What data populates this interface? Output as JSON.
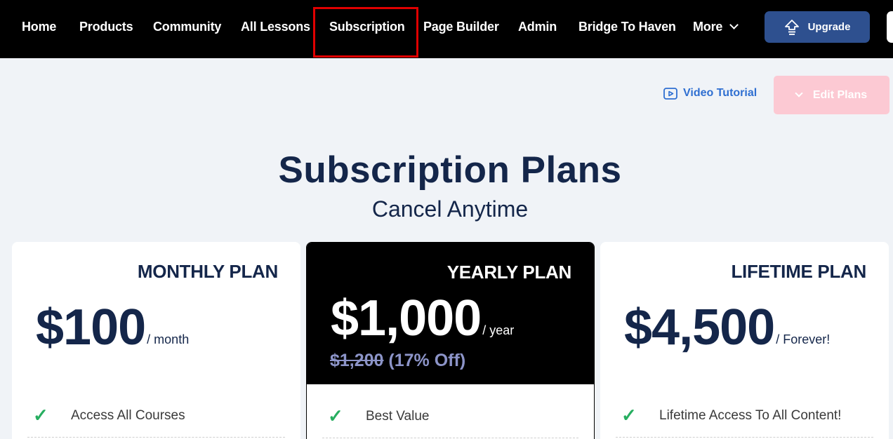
{
  "nav": {
    "items": [
      {
        "label": "Home"
      },
      {
        "label": "Products"
      },
      {
        "label": "Community"
      },
      {
        "label": "All Lessons"
      },
      {
        "label": "Subscription"
      },
      {
        "label": "Page Builder"
      },
      {
        "label": "Admin"
      },
      {
        "label": "Bridge To Haven"
      },
      {
        "label": "More"
      }
    ],
    "upgrade_label": "Upgrade",
    "active_item": "Subscription",
    "highlight_color": "#e00000"
  },
  "toolbar": {
    "video_tutorial_label": "Video Tutorial",
    "edit_plans_label": "Edit Plans"
  },
  "header": {
    "title": "Subscription Plans",
    "subtitle": "Cancel Anytime"
  },
  "plans": [
    {
      "name": "MONTHLY PLAN",
      "price": "$100",
      "period": "/ month",
      "feature": "Access All Courses"
    },
    {
      "name": "YEARLY PLAN",
      "price": "$1,000",
      "period": "/ year",
      "old_price": "$1,200",
      "discount": "(17% Off)",
      "feature": "Best Value"
    },
    {
      "name": "LIFETIME PLAN",
      "price": "$4,500",
      "period": "/ Forever!",
      "feature": "Lifetime Access To All Content!"
    }
  ],
  "icons": {
    "check": "✓",
    "upgrade": "upgrade-arrow-icon",
    "video": "video-play-icon",
    "chevron": "chevron-down-icon"
  },
  "colors": {
    "nav_bg": "#000000",
    "brand_navy": "#14264a",
    "upgrade_bg": "#2e508f",
    "edit_plans_bg": "#fcc9d3",
    "link_blue": "#2f6fd1",
    "check_green": "#27ae60"
  }
}
